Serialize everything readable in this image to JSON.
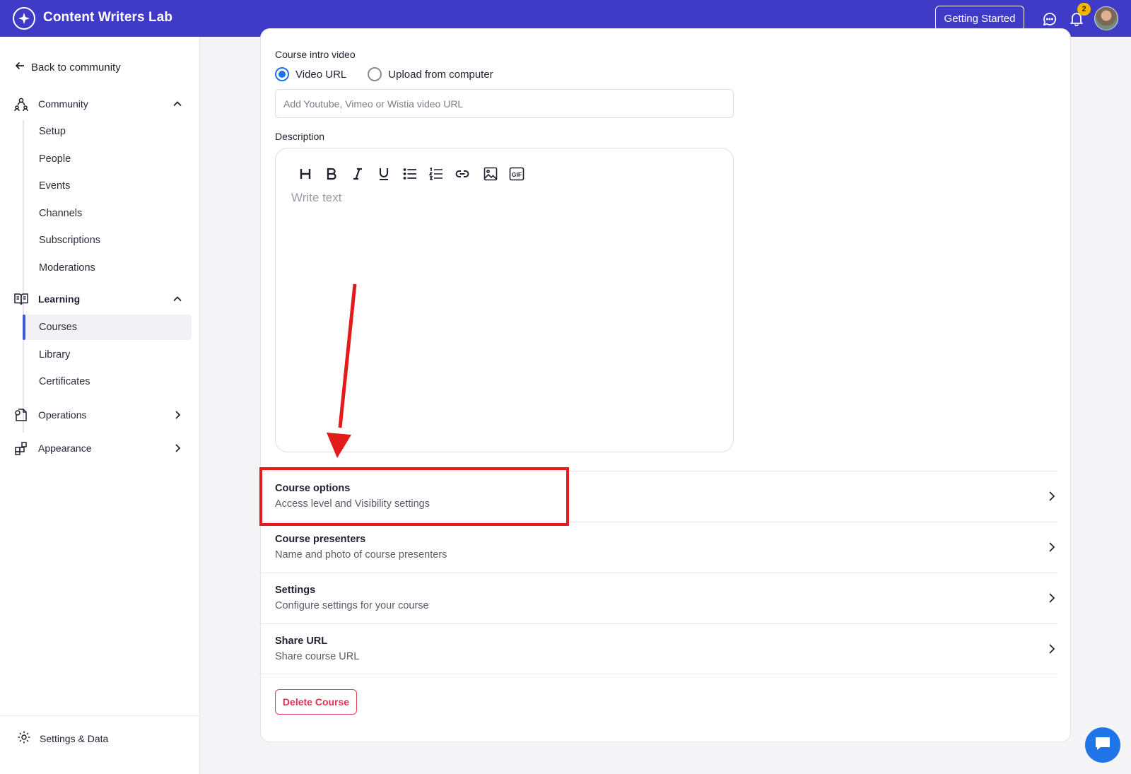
{
  "header": {
    "brand": "Content Writers Lab",
    "getting_started": "Getting Started",
    "notification_count": "2",
    "brand_color": "#3f3bc7"
  },
  "sidebar": {
    "back_label": "Back to community",
    "community": {
      "label": "Community",
      "icon": "community-icon",
      "items": [
        "Setup",
        "People",
        "Events",
        "Channels",
        "Subscriptions",
        "Moderations"
      ]
    },
    "learning": {
      "label": "Learning",
      "icon": "book-icon",
      "items": [
        "Courses",
        "Library",
        "Certificates"
      ],
      "active": "Courses"
    },
    "operations": {
      "label": "Operations",
      "icon": "operations-icon"
    },
    "appearance": {
      "label": "Appearance",
      "icon": "appearance-icon"
    },
    "footer": {
      "label": "Settings & Data",
      "icon": "gear-icon"
    }
  },
  "form": {
    "intro_video_label": "Course intro video",
    "radio_video_url": "Video URL",
    "radio_upload": "Upload from computer",
    "selected_radio": "Video URL",
    "url_placeholder": "Add Youtube, Vimeo or Wistia video URL",
    "description_label": "Description",
    "editor_placeholder": "Write text",
    "toolbar": [
      "heading",
      "bold",
      "italic",
      "underline",
      "bullet-list",
      "numbered-list",
      "link",
      "image",
      "gif"
    ]
  },
  "options": [
    {
      "title": "Course options",
      "subtitle": "Access level and Visibility settings"
    },
    {
      "title": "Course presenters",
      "subtitle": "Name and photo of course presenters"
    },
    {
      "title": "Settings",
      "subtitle": "Configure settings for your course"
    },
    {
      "title": "Share URL",
      "subtitle": "Share course URL"
    }
  ],
  "delete_label": "Delete Course",
  "colors": {
    "accent": "#1e73e8",
    "danger": "#e8304e",
    "annotation": "#e31b1b"
  }
}
